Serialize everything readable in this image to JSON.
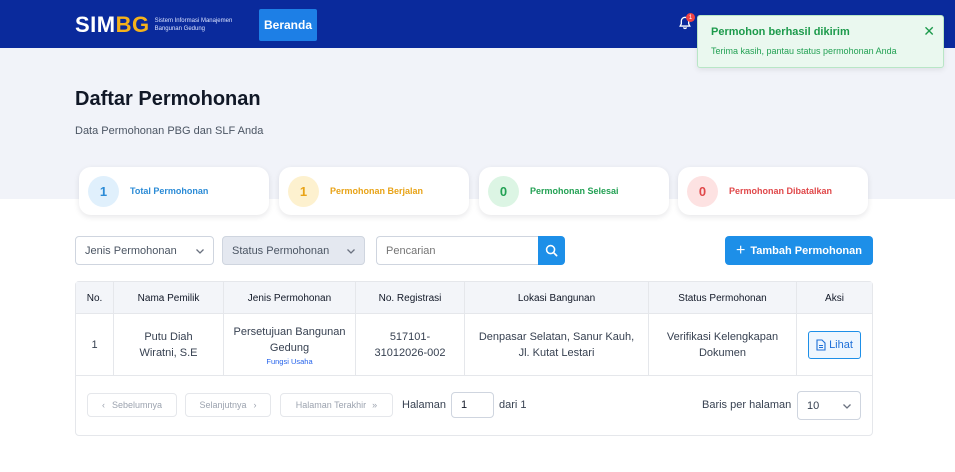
{
  "header": {
    "logo_part1": "SIM",
    "logo_part2": "BG",
    "logo_subtitle": "Sistem Informasi Manajemen Bangunan Gedung",
    "nav_beranda": "Beranda",
    "notification_count": "1"
  },
  "page": {
    "title": "Daftar Permohonan",
    "subtitle": "Data Permohonan PBG dan SLF Anda"
  },
  "stats": [
    {
      "value": "1",
      "label": "Total Permohonan",
      "color": "#2b8bd6",
      "bg": "#e0f0fc"
    },
    {
      "value": "1",
      "label": "Permohonan Berjalan",
      "color": "#e8a317",
      "bg": "#fdf1cf"
    },
    {
      "value": "0",
      "label": "Permohonan Selesai",
      "color": "#23a154",
      "bg": "#dcf5e4"
    },
    {
      "value": "0",
      "label": "Permohonan Dibatalkan",
      "color": "#e0484a",
      "bg": "#fde2e2"
    }
  ],
  "filters": {
    "jenis_label": "Jenis Permohonan",
    "status_label": "Status Permohonan",
    "search_placeholder": "Pencarian",
    "add_button": "Tambah Permohonan"
  },
  "table": {
    "headers": [
      "No.",
      "Nama Pemilik",
      "Jenis Permohonan",
      "No. Registrasi",
      "Lokasi Bangunan",
      "Status Permohonan",
      "Aksi"
    ],
    "rows": [
      {
        "no": "1",
        "nama": "Putu Diah Wiratni, S.E",
        "jenis": "Persetujuan Bangunan Gedung",
        "fungsi": "Fungsi Usaha",
        "registrasi": "517101-31012026-002",
        "lokasi": "Denpasar Selatan, Sanur Kauh, Jl. Kutat Lestari",
        "status": "Verifikasi Kelengkapan Dokumen",
        "aksi": "Lihat"
      }
    ]
  },
  "pagination": {
    "prev": "Sebelumnya",
    "next": "Selanjutnya",
    "last": "Halaman Terakhir",
    "halaman_label": "Halaman",
    "current_page": "1",
    "dari_label": "dari 1",
    "rows_label": "Baris per halaman",
    "rows_value": "10"
  },
  "toast": {
    "title": "Permohon berhasil dikirim",
    "message": "Terima kasih, pantau status permohonan Anda",
    "close": "✕"
  }
}
